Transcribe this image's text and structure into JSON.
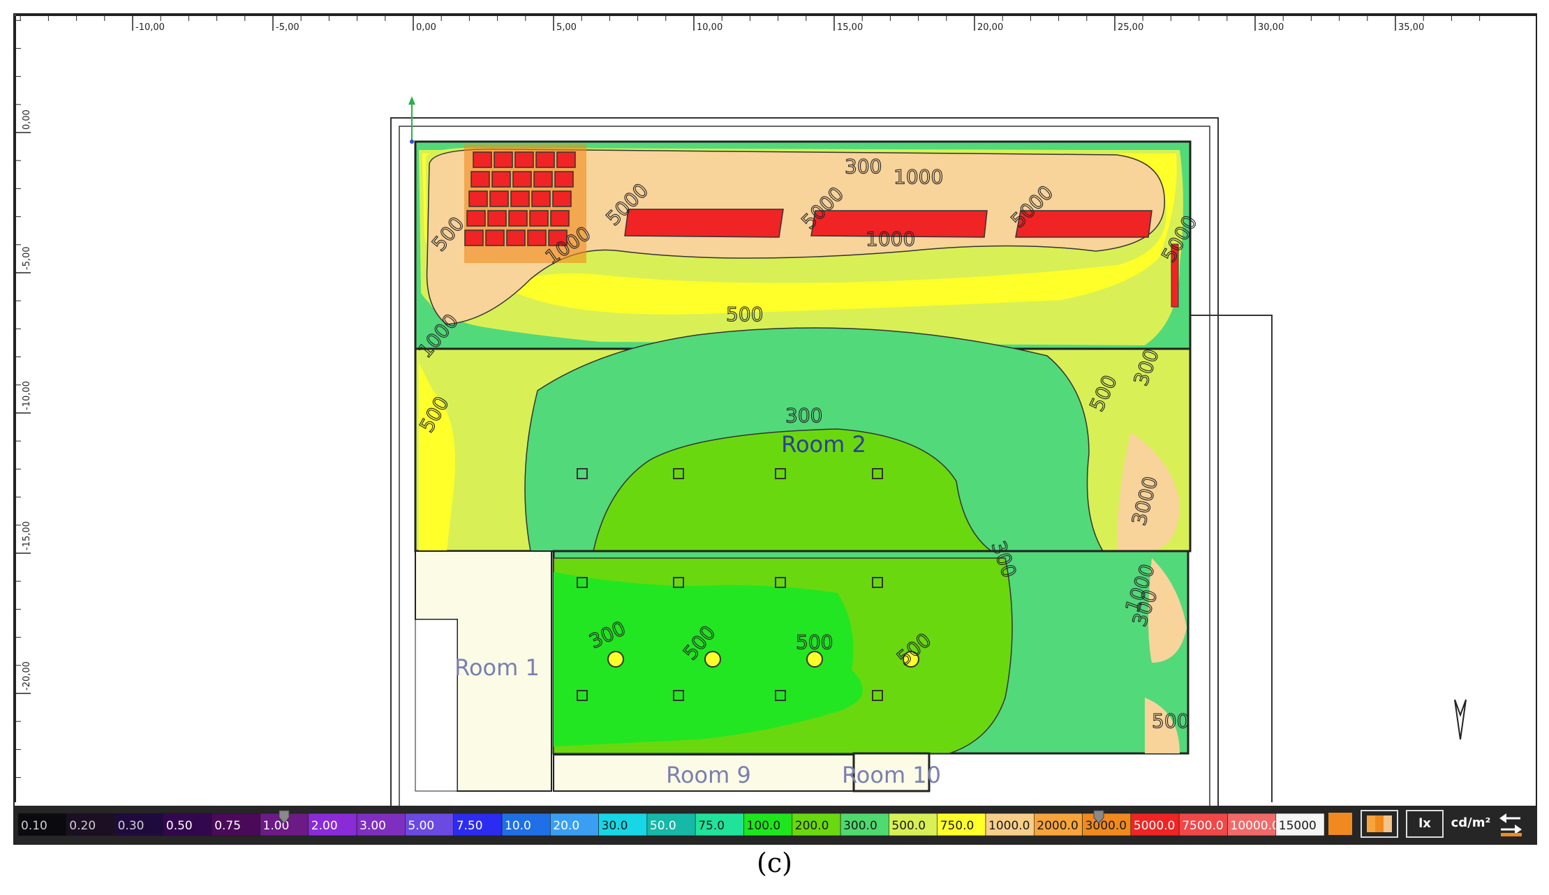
{
  "ruler": {
    "x_ticks": [
      "-10,00",
      "-5,00",
      "0,00",
      "5,00",
      "10,00",
      "15,00",
      "20,00",
      "25,00",
      "30,00",
      "35,00"
    ],
    "y_ticks": [
      "0,00",
      "-5,00",
      "-10,00",
      "-15,00",
      "-20,00"
    ]
  },
  "rooms": {
    "room1": "Room 1",
    "room2": "Room 2",
    "room9": "Room 9",
    "room10": "Room 10"
  },
  "contours": [
    "300",
    "1000",
    "5000",
    "5000",
    "5000",
    "1000",
    "1000",
    "500",
    "500",
    "5000",
    "300",
    "500",
    "500",
    "300",
    "3000",
    "300",
    "1000",
    "300",
    "300",
    "500",
    "500",
    "500",
    "500",
    "1000"
  ],
  "legend": {
    "items": [
      {
        "label": "0.10",
        "color": "#0b0b0f"
      },
      {
        "label": "0.20",
        "color": "#1c0f24"
      },
      {
        "label": "0.30",
        "color": "#1f0a3e"
      },
      {
        "label": "0.50",
        "color": "#33074d"
      },
      {
        "label": "0.75",
        "color": "#4b0a59"
      },
      {
        "label": "1.00",
        "color": "#6b1a86"
      },
      {
        "label": "2.00",
        "color": "#8a2bd8"
      },
      {
        "label": "3.00",
        "color": "#7e2fc0"
      },
      {
        "label": "5.00",
        "color": "#6a4ae0"
      },
      {
        "label": "7.50",
        "color": "#2c2cf0"
      },
      {
        "label": "10.0",
        "color": "#1f6fe6"
      },
      {
        "label": "20.0",
        "color": "#3a9ff2"
      },
      {
        "label": "30.0",
        "color": "#17d6e6"
      },
      {
        "label": "50.0",
        "color": "#16b8a6"
      },
      {
        "label": "75.0",
        "color": "#1fe39a"
      },
      {
        "label": "100.0",
        "color": "#1ee61e"
      },
      {
        "label": "200.0",
        "color": "#6ad80f"
      },
      {
        "label": "300.0",
        "color": "#4fd96e"
      },
      {
        "label": "500.0",
        "color": "#d8f055"
      },
      {
        "label": "750.0",
        "color": "#ffff2a"
      },
      {
        "label": "1000.0",
        "color": "#f7cf8a"
      },
      {
        "label": "2000.0",
        "color": "#f7a43c"
      },
      {
        "label": "3000.0",
        "color": "#f08a1e"
      },
      {
        "label": "5000.0",
        "color": "#f02424"
      },
      {
        "label": "7500.0",
        "color": "#f04848"
      },
      {
        "label": "10000.0",
        "color": "#f06a6a"
      },
      {
        "label": "15000",
        "color": "#f5f5f5"
      }
    ],
    "unit_lx": "lx",
    "unit_cd": "cd/m²"
  },
  "caption": "(c)",
  "colors": {
    "zone_1000": "#f8d39a",
    "zone_500": "#d8f055",
    "zone_750": "#ffff2a",
    "zone_300": "#52d97a",
    "zone_200": "#6ad80f",
    "zone_100": "#22e622",
    "zone_5000": "#f02424",
    "room_fill": "#fbfbe6"
  },
  "icons": {
    "north": "north-arrow-icon",
    "gradient": "gradient-mode-icon",
    "swap": "swap-arrows-icon"
  }
}
